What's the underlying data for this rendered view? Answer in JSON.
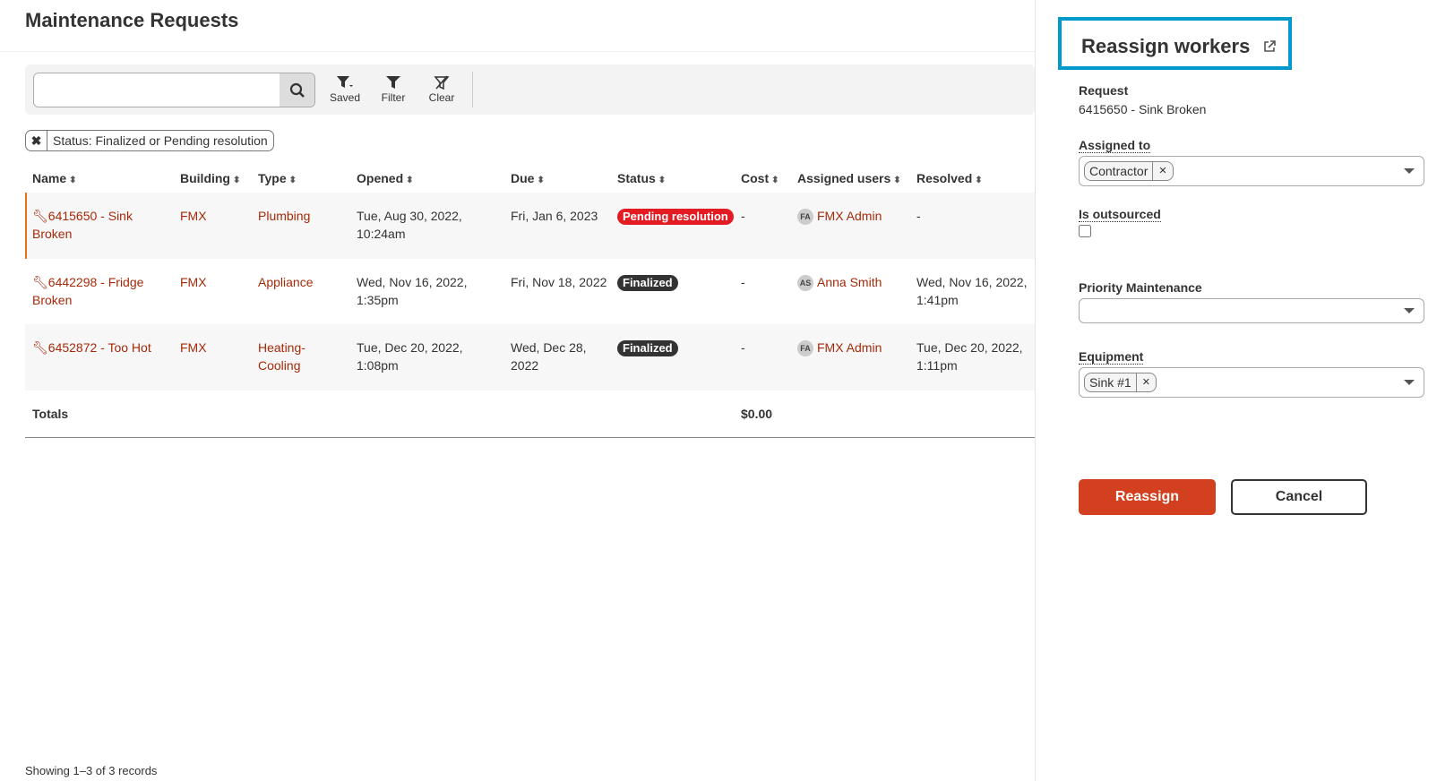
{
  "page": {
    "title": "Maintenance Requests"
  },
  "toolbar": {
    "search_value": "",
    "saved": "Saved",
    "filter": "Filter",
    "clear": "Clear"
  },
  "filter_chip": "Status: Finalized or Pending resolution",
  "table": {
    "headers": [
      "Name",
      "Building",
      "Type",
      "Opened",
      "Due",
      "Status",
      "Cost",
      "Assigned users",
      "Resolved"
    ],
    "rows": [
      {
        "name": "6415650 - Sink Broken",
        "building": "FMX",
        "type": "Plumbing",
        "opened": "Tue, Aug 30, 2022, 10:24am",
        "due": "Fri, Jan 6, 2023",
        "status": "Pending resolution",
        "status_color": "#e31b23",
        "cost": "-",
        "user_initials": "FA",
        "user": "FMX Admin",
        "resolved": "-"
      },
      {
        "name": "6442298 - Fridge Broken",
        "building": "FMX",
        "type": "Appliance",
        "opened": "Wed, Nov 16, 2022, 1:35pm",
        "due": "Fri, Nov 18, 2022",
        "status": "Finalized",
        "status_color": "#333333",
        "cost": "-",
        "user_initials": "AS",
        "user": "Anna Smith",
        "resolved": "Wed, Nov 16, 2022, 1:41pm"
      },
      {
        "name": "6452872 - Too Hot",
        "building": "FMX",
        "type": "Heating-Cooling",
        "opened": "Tue, Dec 20, 2022, 1:08pm",
        "due": "Wed, Dec 28, 2022",
        "status": "Finalized",
        "status_color": "#333333",
        "cost": "-",
        "user_initials": "FA",
        "user": "FMX Admin",
        "resolved": "Tue, Dec 20, 2022, 1:11pm"
      }
    ],
    "totals_label": "Totals",
    "totals_cost": "$0.00"
  },
  "footer": "Showing 1–3 of 3 records",
  "panel": {
    "title": "Reassign workers",
    "request_label": "Request",
    "request_value": "6415650 - Sink Broken",
    "assigned_label": "Assigned to",
    "assigned_tag": "Contractor",
    "outsourced_label": "Is outsourced",
    "priority_label": "Priority Maintenance",
    "equipment_label": "Equipment",
    "equipment_tag": "Sink #1",
    "reassign": "Reassign",
    "cancel": "Cancel",
    "accent": "#d2401f"
  }
}
